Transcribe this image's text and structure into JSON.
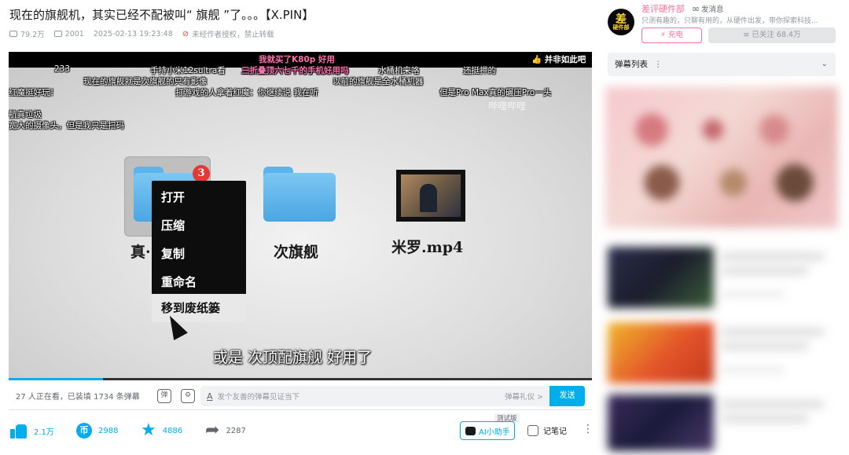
{
  "video": {
    "title": "现在的旗舰机，其实已经不配被叫“ 旗舰 ”了。。。【X.PIN】",
    "views": "79.2万",
    "danmaku_count": "2001",
    "date": "2025-02-13 19:23:48",
    "copyright": "未经作者授权，禁止转载"
  },
  "player": {
    "watermark": "哔哩哔哩",
    "subtitle": "或是 次顶配旗舰 好用了",
    "badge": "3",
    "context_menu": [
      "打开",
      "压缩",
      "复制",
      "重命名",
      "移到废纸篓"
    ],
    "file_labels": [
      "真·",
      "次旗舰",
      "米罗.mp4"
    ],
    "danmaku": [
      {
        "text": "我就买了K80p  好用",
        "style": "pink"
      },
      {
        "text": "233",
        "style": "normal"
      },
      {
        "text": "手持小米12sultra看",
        "style": "normal"
      },
      {
        "text": "三折叠顶六七千的手机好用吗",
        "style": "pink"
      },
      {
        "text": "水桶机来咯",
        "style": "normal"
      },
      {
        "text": "还挺押的",
        "style": "normal"
      },
      {
        "text": "👍 并非如此吧",
        "style": "bold"
      },
      {
        "text": "现在的旗舰就是次旗舰的只有影像",
        "style": "normal"
      },
      {
        "text": "以前的旗舰是全水桶机器",
        "style": "normal"
      },
      {
        "text": "红魔挺好玩！",
        "style": "normal"
      },
      {
        "text": "打游戏的人拿着红魔：你继续说  我在听",
        "style": "normal"
      },
      {
        "text": "但是Pro Max真的碾压Pro一头",
        "style": "normal"
      },
      {
        "text": "航真垃圾",
        "style": "normal"
      },
      {
        "text": "宽大的摄像头，但是我只是扫码",
        "style": "normal"
      }
    ]
  },
  "danmaku_bar": {
    "status": "27 人正在看，已装填 1734 条弹幕",
    "placeholder": "发个友善的弹幕见证当下",
    "etiquette": "弹幕礼仪 >",
    "send": "发送"
  },
  "actions": {
    "like": "2.1万",
    "coin": "2988",
    "favorite": "4886",
    "share": "2287",
    "ai_tag": "测试版",
    "ai_assistant": "AI小助手",
    "notes": "记笔记"
  },
  "uploader": {
    "avatar_text": "差",
    "avatar_sub": "硬件部",
    "name": "差评硬件部",
    "message": "发消息",
    "desc": "只测有趣的，只聊有用的，从硬件出发，带你探索科技...",
    "charge": "充电",
    "follow": "已关注 68.4万"
  },
  "sidebar": {
    "danmaku_list": "弹幕列表"
  },
  "colors": {
    "accent": "#00aeec",
    "pink": "#fb7299",
    "danger": "#e0424a"
  }
}
